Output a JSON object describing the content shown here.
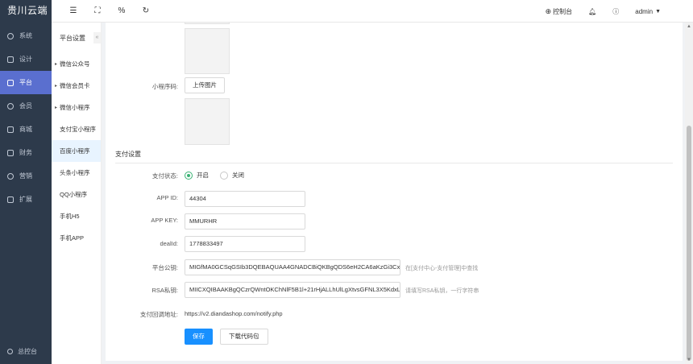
{
  "brand": "贵川云端",
  "sidebar": {
    "items": [
      {
        "label": "系统",
        "icon": "gear-icon"
      },
      {
        "label": "设计",
        "icon": "design-icon"
      },
      {
        "label": "平台",
        "icon": "platform-icon"
      },
      {
        "label": "会员",
        "icon": "user-icon"
      },
      {
        "label": "商城",
        "icon": "store-icon"
      },
      {
        "label": "财务",
        "icon": "finance-icon"
      },
      {
        "label": "营销",
        "icon": "marketing-icon"
      },
      {
        "label": "扩展",
        "icon": "extend-icon"
      }
    ],
    "active_index": 2,
    "footer": "总控台"
  },
  "header": {
    "right": {
      "console": "控制台",
      "user": "admin"
    }
  },
  "subnav": {
    "title": "平台设置",
    "collapse": "«",
    "items": [
      {
        "label": "微信公众号",
        "caret": true
      },
      {
        "label": "微信会员卡",
        "caret": true
      },
      {
        "label": "微信小程序",
        "caret": true
      },
      {
        "label": "支付宝小程序",
        "caret": false
      },
      {
        "label": "百度小程序",
        "caret": false
      },
      {
        "label": "头条小程序",
        "caret": false
      },
      {
        "label": "QQ小程序",
        "caret": false
      },
      {
        "label": "手机H5",
        "caret": false
      },
      {
        "label": "手机APP",
        "caret": false
      }
    ],
    "active_index": 4
  },
  "form": {
    "miniprogram_code_label": "小程序码:",
    "upload_label": "上传图片",
    "pay_section_title": "支付设置",
    "pay_status_label": "支付状态:",
    "pay_on": "开启",
    "pay_off": "关闭",
    "app_id_label": "APP ID:",
    "app_id_value": "44304",
    "app_key_label": "APP KEY:",
    "app_key_value": "MMURHR",
    "deal_id_label": "dealId:",
    "deal_id_value": "1778833497",
    "platform_pubkey_label": "平台公钥:",
    "platform_pubkey_value": "MIGfMA0GCSqGSIb3DQEBAQUAA4GNADCBiQKBgQDS6eH2CA6aKzGi3Cx",
    "platform_pubkey_hint": "在[支付中心-支付管理]中查找",
    "rsa_key_label": "RSA私钥:",
    "rsa_key_value": "MIICXQIBAAKBgQCzrQWntOKChNlF5B1l+21rHjALLhUlLgXtvsGFNL3X5KdxL",
    "rsa_key_hint": "请填写RSA私钥，一行字符串",
    "callback_label": "支付回调地址:",
    "callback_value": "https://v2.diandashop.com/notify.php",
    "save": "保存",
    "download": "下载代码包"
  }
}
